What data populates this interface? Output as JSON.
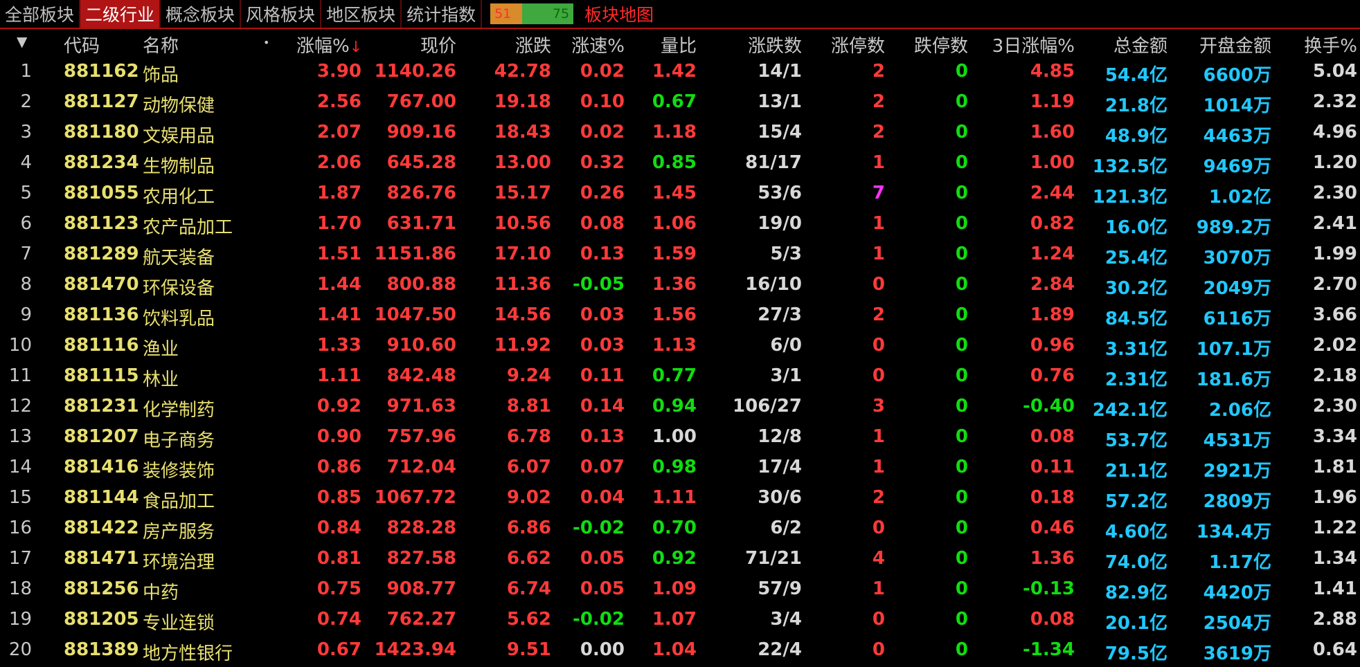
{
  "tabs": [
    {
      "label": "全部板块",
      "active": false
    },
    {
      "label": "二级行业",
      "active": true
    },
    {
      "label": "概念板块",
      "active": false
    },
    {
      "label": "风格板块",
      "active": false
    },
    {
      "label": "地区板块",
      "active": false
    },
    {
      "label": "统计指数",
      "active": false
    }
  ],
  "breadth": {
    "up": "51",
    "down": "75"
  },
  "map_label": "板块地图",
  "columns": {
    "code": "代码",
    "name": "名称",
    "dot": "•",
    "pct": "涨幅%",
    "sort_arrow": "↓",
    "price": "现价",
    "change": "涨跌",
    "speed": "涨速%",
    "vol_ratio": "量比",
    "updown": "涨跌数",
    "limit_up": "涨停数",
    "limit_down": "跌停数",
    "pct3d": "3日涨幅%",
    "amount": "总金额",
    "open_amount": "开盘金额",
    "turnover": "换手%"
  },
  "colors": {
    "up": "#ff3a3a",
    "down": "#10dd10",
    "flat": "#d8d8d8",
    "money": "#20c8ff",
    "code": "#e8e070",
    "accent": "#b01414"
  },
  "rows": [
    {
      "n": "1",
      "code": "881162",
      "name": "饰品",
      "pct": "3.90",
      "price": "1140.26",
      "chg": "42.78",
      "speed": "0.02",
      "vr": "1.42",
      "ud": "14/1",
      "lu": "2",
      "ld": "0",
      "p3": "4.85",
      "amt": "54.4亿",
      "oamt": "6600万",
      "to": "5.04"
    },
    {
      "n": "2",
      "code": "881127",
      "name": "动物保健",
      "pct": "2.56",
      "price": "767.00",
      "chg": "19.18",
      "speed": "0.10",
      "vr": "0.67",
      "ud": "13/1",
      "lu": "2",
      "ld": "0",
      "p3": "1.19",
      "amt": "21.8亿",
      "oamt": "1014万",
      "to": "2.32"
    },
    {
      "n": "3",
      "code": "881180",
      "name": "文娱用品",
      "pct": "2.07",
      "price": "909.16",
      "chg": "18.43",
      "speed": "0.02",
      "vr": "1.18",
      "ud": "15/4",
      "lu": "2",
      "ld": "0",
      "p3": "1.60",
      "amt": "48.9亿",
      "oamt": "4463万",
      "to": "4.96"
    },
    {
      "n": "4",
      "code": "881234",
      "name": "生物制品",
      "pct": "2.06",
      "price": "645.28",
      "chg": "13.00",
      "speed": "0.32",
      "vr": "0.85",
      "ud": "81/17",
      "lu": "1",
      "ld": "0",
      "p3": "1.00",
      "amt": "132.5亿",
      "oamt": "9469万",
      "to": "1.20"
    },
    {
      "n": "5",
      "code": "881055",
      "name": "农用化工",
      "pct": "1.87",
      "price": "826.76",
      "chg": "15.17",
      "speed": "0.26",
      "vr": "1.45",
      "ud": "53/6",
      "lu": "7",
      "ld": "0",
      "p3": "2.44",
      "amt": "121.3亿",
      "oamt": "1.02亿",
      "to": "2.30"
    },
    {
      "n": "6",
      "code": "881123",
      "name": "农产品加工",
      "pct": "1.70",
      "price": "631.71",
      "chg": "10.56",
      "speed": "0.08",
      "vr": "1.06",
      "ud": "19/0",
      "lu": "1",
      "ld": "0",
      "p3": "0.82",
      "amt": "16.0亿",
      "oamt": "989.2万",
      "to": "2.41"
    },
    {
      "n": "7",
      "code": "881289",
      "name": "航天装备",
      "pct": "1.51",
      "price": "1151.86",
      "chg": "17.10",
      "speed": "0.13",
      "vr": "1.59",
      "ud": "5/3",
      "lu": "1",
      "ld": "0",
      "p3": "1.24",
      "amt": "25.4亿",
      "oamt": "3070万",
      "to": "1.99"
    },
    {
      "n": "8",
      "code": "881470",
      "name": "环保设备",
      "pct": "1.44",
      "price": "800.88",
      "chg": "11.36",
      "speed": "-0.05",
      "vr": "1.36",
      "ud": "16/10",
      "lu": "0",
      "ld": "0",
      "p3": "2.84",
      "amt": "30.2亿",
      "oamt": "2049万",
      "to": "2.70"
    },
    {
      "n": "9",
      "code": "881136",
      "name": "饮料乳品",
      "pct": "1.41",
      "price": "1047.50",
      "chg": "14.56",
      "speed": "0.03",
      "vr": "1.56",
      "ud": "27/3",
      "lu": "2",
      "ld": "0",
      "p3": "1.89",
      "amt": "84.5亿",
      "oamt": "6116万",
      "to": "3.66"
    },
    {
      "n": "10",
      "code": "881116",
      "name": "渔业",
      "pct": "1.33",
      "price": "910.60",
      "chg": "11.92",
      "speed": "0.03",
      "vr": "1.13",
      "ud": "6/0",
      "lu": "0",
      "ld": "0",
      "p3": "0.96",
      "amt": "3.31亿",
      "oamt": "107.1万",
      "to": "2.02"
    },
    {
      "n": "11",
      "code": "881115",
      "name": "林业",
      "pct": "1.11",
      "price": "842.48",
      "chg": "9.24",
      "speed": "0.11",
      "vr": "0.77",
      "ud": "3/1",
      "lu": "0",
      "ld": "0",
      "p3": "0.76",
      "amt": "2.31亿",
      "oamt": "181.6万",
      "to": "2.18"
    },
    {
      "n": "12",
      "code": "881231",
      "name": "化学制药",
      "pct": "0.92",
      "price": "971.63",
      "chg": "8.81",
      "speed": "0.14",
      "vr": "0.94",
      "ud": "106/27",
      "lu": "3",
      "ld": "0",
      "p3": "-0.40",
      "amt": "242.1亿",
      "oamt": "2.06亿",
      "to": "2.30"
    },
    {
      "n": "13",
      "code": "881207",
      "name": "电子商务",
      "pct": "0.90",
      "price": "757.96",
      "chg": "6.78",
      "speed": "0.13",
      "vr": "1.00",
      "ud": "12/8",
      "lu": "1",
      "ld": "0",
      "p3": "0.08",
      "amt": "53.7亿",
      "oamt": "4531万",
      "to": "3.34"
    },
    {
      "n": "14",
      "code": "881416",
      "name": "装修装饰",
      "pct": "0.86",
      "price": "712.04",
      "chg": "6.07",
      "speed": "0.07",
      "vr": "0.98",
      "ud": "17/4",
      "lu": "1",
      "ld": "0",
      "p3": "0.11",
      "amt": "21.1亿",
      "oamt": "2921万",
      "to": "1.81"
    },
    {
      "n": "15",
      "code": "881144",
      "name": "食品加工",
      "pct": "0.85",
      "price": "1067.72",
      "chg": "9.02",
      "speed": "0.04",
      "vr": "1.11",
      "ud": "30/6",
      "lu": "2",
      "ld": "0",
      "p3": "0.18",
      "amt": "57.2亿",
      "oamt": "2809万",
      "to": "1.96"
    },
    {
      "n": "16",
      "code": "881422",
      "name": "房产服务",
      "pct": "0.84",
      "price": "828.28",
      "chg": "6.86",
      "speed": "-0.02",
      "vr": "0.70",
      "ud": "6/2",
      "lu": "0",
      "ld": "0",
      "p3": "0.46",
      "amt": "4.60亿",
      "oamt": "134.4万",
      "to": "1.22"
    },
    {
      "n": "17",
      "code": "881471",
      "name": "环境治理",
      "pct": "0.81",
      "price": "827.58",
      "chg": "6.62",
      "speed": "0.05",
      "vr": "0.92",
      "ud": "71/21",
      "lu": "4",
      "ld": "0",
      "p3": "1.36",
      "amt": "74.0亿",
      "oamt": "1.17亿",
      "to": "1.34"
    },
    {
      "n": "18",
      "code": "881256",
      "name": "中药",
      "pct": "0.75",
      "price": "908.77",
      "chg": "6.74",
      "speed": "0.05",
      "vr": "1.09",
      "ud": "57/9",
      "lu": "1",
      "ld": "0",
      "p3": "-0.13",
      "amt": "82.9亿",
      "oamt": "4420万",
      "to": "1.41"
    },
    {
      "n": "19",
      "code": "881205",
      "name": "专业连锁",
      "pct": "0.74",
      "price": "762.27",
      "chg": "5.62",
      "speed": "-0.02",
      "vr": "1.07",
      "ud": "3/4",
      "lu": "0",
      "ld": "0",
      "p3": "0.08",
      "amt": "20.1亿",
      "oamt": "2504万",
      "to": "2.88"
    },
    {
      "n": "20",
      "code": "881389",
      "name": "地方性银行",
      "pct": "0.67",
      "price": "1423.94",
      "chg": "9.51",
      "speed": "0.00",
      "vr": "1.04",
      "ud": "22/4",
      "lu": "0",
      "ld": "0",
      "p3": "-1.34",
      "amt": "79.5亿",
      "oamt": "3619万",
      "to": "0.64"
    }
  ]
}
